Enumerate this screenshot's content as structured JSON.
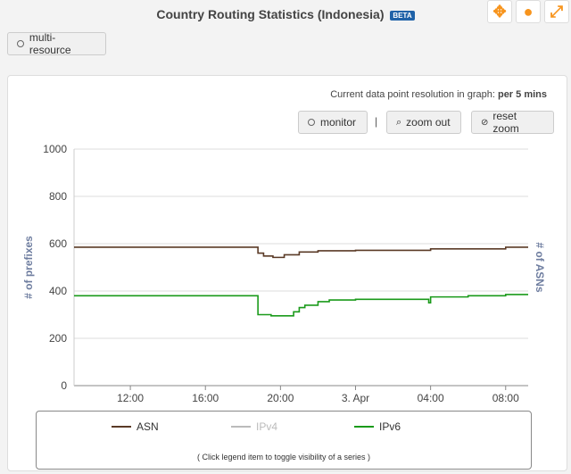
{
  "header": {
    "title": "Country Routing Statistics (Indonesia)",
    "badge": "BETA"
  },
  "top_icons": [
    "move-icon",
    "comment-icon",
    "expand-icon"
  ],
  "multi_resource_label": "multi-resource",
  "resolution": {
    "prefix": "Current data point resolution in graph:",
    "value": "per 5 mins"
  },
  "toolbar": {
    "monitor": "monitor",
    "separator": "|",
    "zoom_out": "zoom out",
    "reset_zoom": "reset zoom"
  },
  "legend": {
    "note": "( Click legend item to toggle visibility of a series )"
  },
  "chart_data": {
    "type": "line",
    "ylabel": "# of prefixes",
    "ylabel_right": "# of ASNs",
    "ylim": [
      0,
      1000
    ],
    "y_ticks": [
      "0",
      "200",
      "400",
      "600",
      "800",
      "1000"
    ],
    "x_ticks": [
      "12:00",
      "16:00",
      "20:00",
      "3. Apr",
      "04:00",
      "08:00"
    ],
    "x_tick_hours": [
      12,
      16,
      20,
      24,
      28,
      32
    ],
    "xlim_hours": [
      9.0,
      33.2
    ],
    "series": [
      {
        "name": "ASN",
        "color": "#5a3a26",
        "visible": true,
        "x": [
          9.0,
          18.5,
          18.8,
          19.1,
          19.6,
          20.2,
          21.0,
          22.0,
          24.0,
          28.0,
          32.0,
          33.2
        ],
        "values": [
          585,
          585,
          560,
          548,
          542,
          553,
          565,
          570,
          572,
          578,
          585,
          585
        ]
      },
      {
        "name": "IPv4",
        "color": "#bbbbbb",
        "visible": false,
        "x": [],
        "values": []
      },
      {
        "name": "IPv6",
        "color": "#1a9a1a",
        "visible": true,
        "x": [
          9.0,
          18.5,
          18.8,
          19.4,
          19.5,
          20.6,
          20.7,
          21.0,
          21.3,
          22.0,
          22.6,
          23.0,
          24.0,
          26.0,
          27.9,
          28.0,
          30.0,
          32.0,
          33.2
        ],
        "values": [
          380,
          380,
          300,
          300,
          295,
          295,
          312,
          330,
          340,
          355,
          362,
          362,
          365,
          365,
          350,
          375,
          380,
          385,
          385
        ]
      }
    ]
  }
}
